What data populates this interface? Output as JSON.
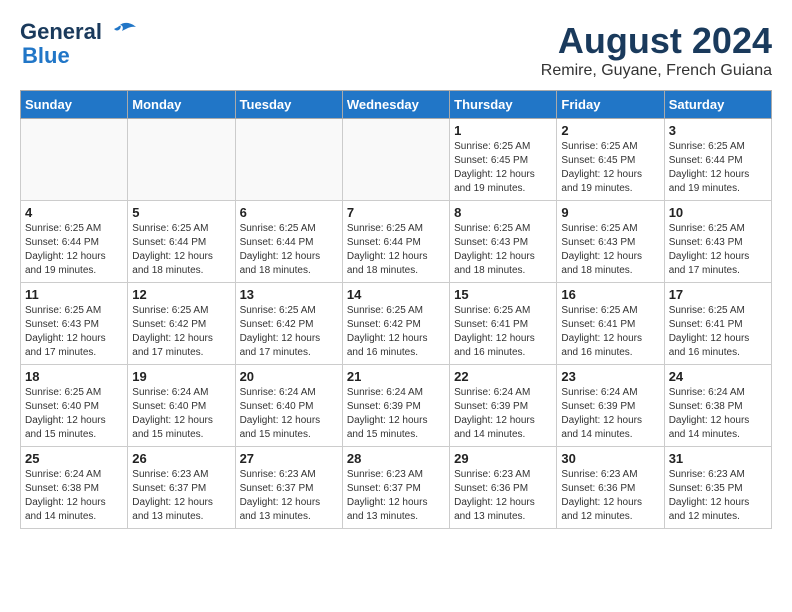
{
  "header": {
    "logo_line1": "General",
    "logo_line2": "Blue",
    "main_title": "August 2024",
    "subtitle": "Remire, Guyane, French Guiana"
  },
  "days_of_week": [
    "Sunday",
    "Monday",
    "Tuesday",
    "Wednesday",
    "Thursday",
    "Friday",
    "Saturday"
  ],
  "weeks": [
    [
      {
        "day": "",
        "info": ""
      },
      {
        "day": "",
        "info": ""
      },
      {
        "day": "",
        "info": ""
      },
      {
        "day": "",
        "info": ""
      },
      {
        "day": "1",
        "info": "Sunrise: 6:25 AM\nSunset: 6:45 PM\nDaylight: 12 hours\nand 19 minutes."
      },
      {
        "day": "2",
        "info": "Sunrise: 6:25 AM\nSunset: 6:45 PM\nDaylight: 12 hours\nand 19 minutes."
      },
      {
        "day": "3",
        "info": "Sunrise: 6:25 AM\nSunset: 6:44 PM\nDaylight: 12 hours\nand 19 minutes."
      }
    ],
    [
      {
        "day": "4",
        "info": "Sunrise: 6:25 AM\nSunset: 6:44 PM\nDaylight: 12 hours\nand 19 minutes."
      },
      {
        "day": "5",
        "info": "Sunrise: 6:25 AM\nSunset: 6:44 PM\nDaylight: 12 hours\nand 18 minutes."
      },
      {
        "day": "6",
        "info": "Sunrise: 6:25 AM\nSunset: 6:44 PM\nDaylight: 12 hours\nand 18 minutes."
      },
      {
        "day": "7",
        "info": "Sunrise: 6:25 AM\nSunset: 6:44 PM\nDaylight: 12 hours\nand 18 minutes."
      },
      {
        "day": "8",
        "info": "Sunrise: 6:25 AM\nSunset: 6:43 PM\nDaylight: 12 hours\nand 18 minutes."
      },
      {
        "day": "9",
        "info": "Sunrise: 6:25 AM\nSunset: 6:43 PM\nDaylight: 12 hours\nand 18 minutes."
      },
      {
        "day": "10",
        "info": "Sunrise: 6:25 AM\nSunset: 6:43 PM\nDaylight: 12 hours\nand 17 minutes."
      }
    ],
    [
      {
        "day": "11",
        "info": "Sunrise: 6:25 AM\nSunset: 6:43 PM\nDaylight: 12 hours\nand 17 minutes."
      },
      {
        "day": "12",
        "info": "Sunrise: 6:25 AM\nSunset: 6:42 PM\nDaylight: 12 hours\nand 17 minutes."
      },
      {
        "day": "13",
        "info": "Sunrise: 6:25 AM\nSunset: 6:42 PM\nDaylight: 12 hours\nand 17 minutes."
      },
      {
        "day": "14",
        "info": "Sunrise: 6:25 AM\nSunset: 6:42 PM\nDaylight: 12 hours\nand 16 minutes."
      },
      {
        "day": "15",
        "info": "Sunrise: 6:25 AM\nSunset: 6:41 PM\nDaylight: 12 hours\nand 16 minutes."
      },
      {
        "day": "16",
        "info": "Sunrise: 6:25 AM\nSunset: 6:41 PM\nDaylight: 12 hours\nand 16 minutes."
      },
      {
        "day": "17",
        "info": "Sunrise: 6:25 AM\nSunset: 6:41 PM\nDaylight: 12 hours\nand 16 minutes."
      }
    ],
    [
      {
        "day": "18",
        "info": "Sunrise: 6:25 AM\nSunset: 6:40 PM\nDaylight: 12 hours\nand 15 minutes."
      },
      {
        "day": "19",
        "info": "Sunrise: 6:24 AM\nSunset: 6:40 PM\nDaylight: 12 hours\nand 15 minutes."
      },
      {
        "day": "20",
        "info": "Sunrise: 6:24 AM\nSunset: 6:40 PM\nDaylight: 12 hours\nand 15 minutes."
      },
      {
        "day": "21",
        "info": "Sunrise: 6:24 AM\nSunset: 6:39 PM\nDaylight: 12 hours\nand 15 minutes."
      },
      {
        "day": "22",
        "info": "Sunrise: 6:24 AM\nSunset: 6:39 PM\nDaylight: 12 hours\nand 14 minutes."
      },
      {
        "day": "23",
        "info": "Sunrise: 6:24 AM\nSunset: 6:39 PM\nDaylight: 12 hours\nand 14 minutes."
      },
      {
        "day": "24",
        "info": "Sunrise: 6:24 AM\nSunset: 6:38 PM\nDaylight: 12 hours\nand 14 minutes."
      }
    ],
    [
      {
        "day": "25",
        "info": "Sunrise: 6:24 AM\nSunset: 6:38 PM\nDaylight: 12 hours\nand 14 minutes."
      },
      {
        "day": "26",
        "info": "Sunrise: 6:23 AM\nSunset: 6:37 PM\nDaylight: 12 hours\nand 13 minutes."
      },
      {
        "day": "27",
        "info": "Sunrise: 6:23 AM\nSunset: 6:37 PM\nDaylight: 12 hours\nand 13 minutes."
      },
      {
        "day": "28",
        "info": "Sunrise: 6:23 AM\nSunset: 6:37 PM\nDaylight: 12 hours\nand 13 minutes."
      },
      {
        "day": "29",
        "info": "Sunrise: 6:23 AM\nSunset: 6:36 PM\nDaylight: 12 hours\nand 13 minutes."
      },
      {
        "day": "30",
        "info": "Sunrise: 6:23 AM\nSunset: 6:36 PM\nDaylight: 12 hours\nand 12 minutes."
      },
      {
        "day": "31",
        "info": "Sunrise: 6:23 AM\nSunset: 6:35 PM\nDaylight: 12 hours\nand 12 minutes."
      }
    ]
  ]
}
